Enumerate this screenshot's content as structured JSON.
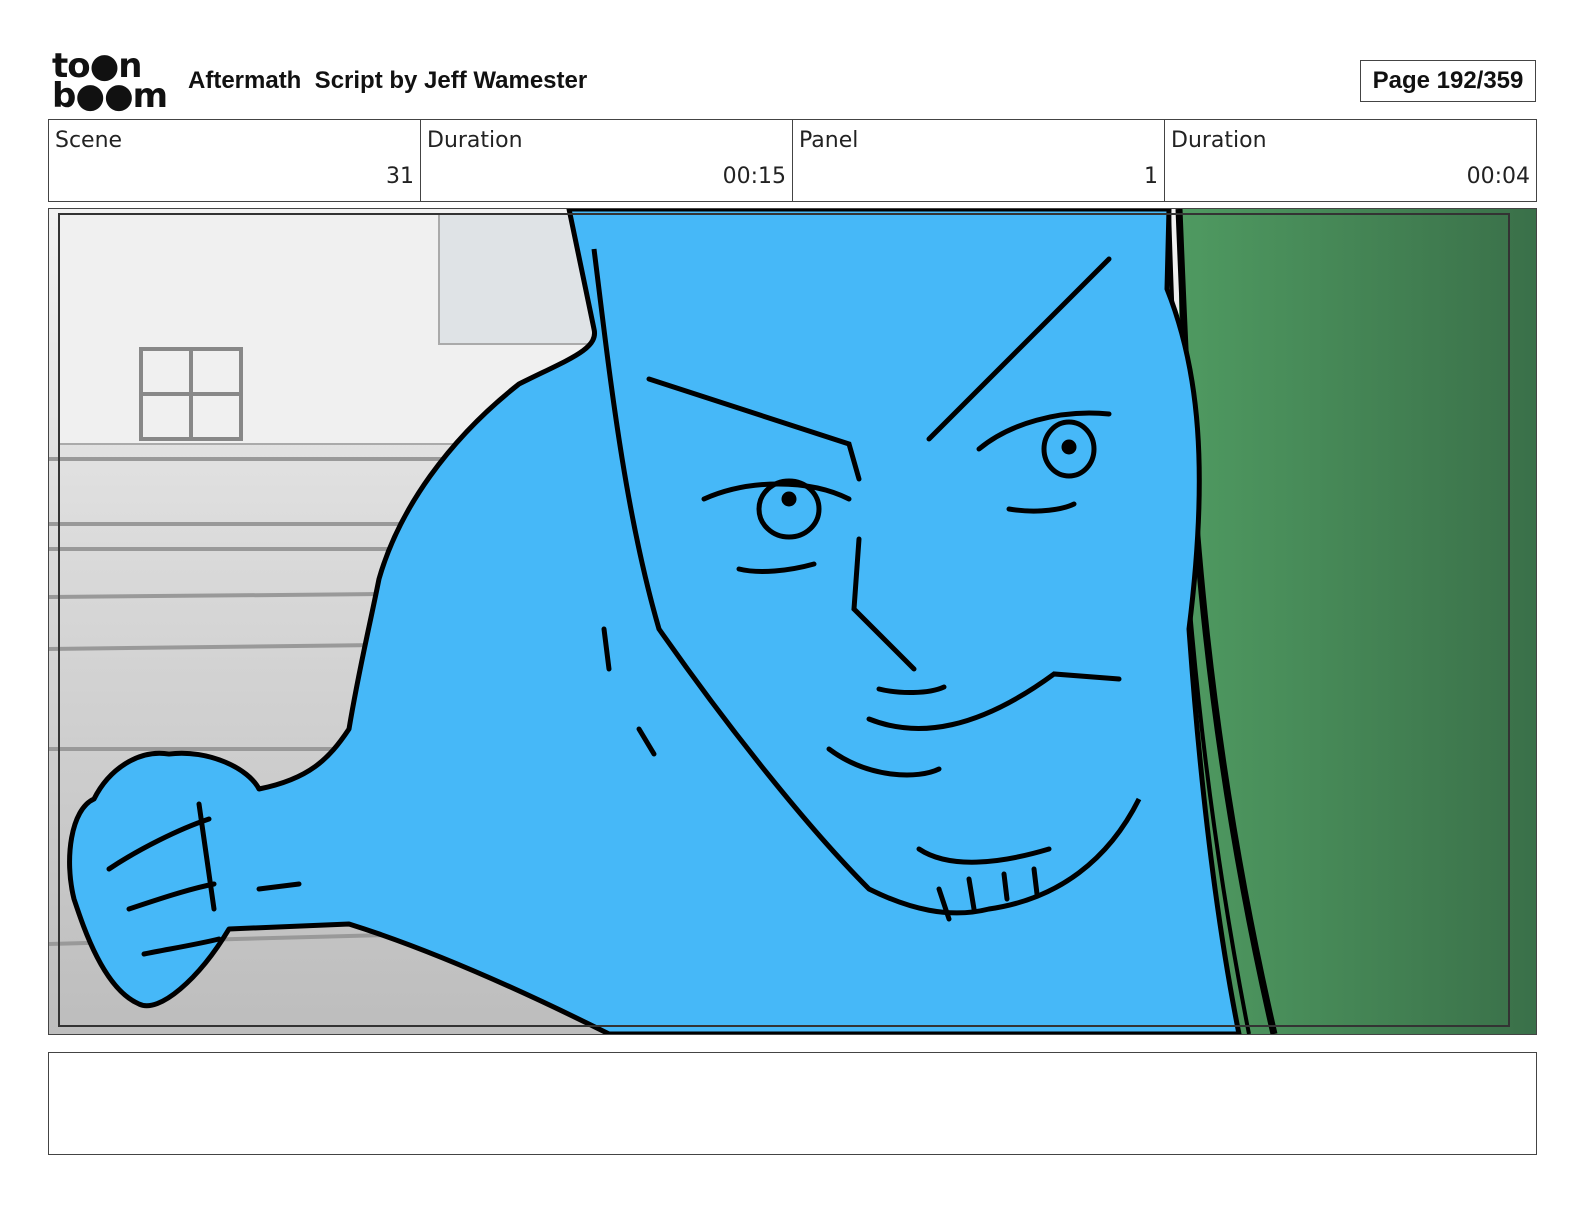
{
  "header": {
    "logo_top": "to●n",
    "logo_bottom": "b●●m",
    "title": "Aftermath  Script by Jeff Wamester",
    "page": "Page 192/359"
  },
  "info": [
    {
      "label": "Scene",
      "value": "31"
    },
    {
      "label": "Duration",
      "value": "00:15"
    },
    {
      "label": "Panel",
      "value": "1"
    },
    {
      "label": "Duration",
      "value": "00:04"
    }
  ],
  "notes": {
    "text": ""
  },
  "colors": {
    "character": "#46b8f8",
    "wall": "#4c8f5c",
    "background": "#e8e8e8",
    "line": "#000000"
  }
}
